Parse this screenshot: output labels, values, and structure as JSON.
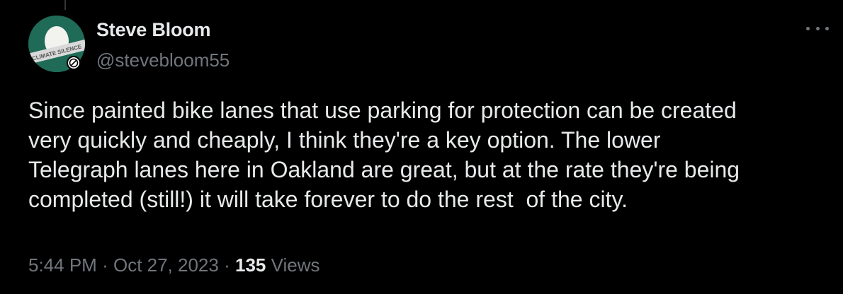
{
  "author": {
    "display_name": "Steve Bloom",
    "handle": "@stevebloom55",
    "avatar_text": "CLIMATE SILENCE",
    "avatar_icon": "egg-avatar-icon",
    "badge_icon": "no-symbol-icon"
  },
  "tweet": {
    "text": "Since painted bike lanes that use parking for protection can be created\nvery quickly and cheaply, I think they're a key option. The lower\nTelegraph lanes here in Oakland are great, but at the rate they're being\ncompleted (still!) it will take forever to do the rest  of the city."
  },
  "meta": {
    "time": "5:44 PM",
    "separator": "·",
    "date": "Oct 27, 2023",
    "views_count": "135",
    "views_label": "Views"
  },
  "more_icon": "more-horizontal-icon",
  "colors": {
    "background": "#000000",
    "primary_text": "#e7e9ea",
    "secondary_text": "#71767b",
    "avatar_bg": "#1f6b57"
  }
}
